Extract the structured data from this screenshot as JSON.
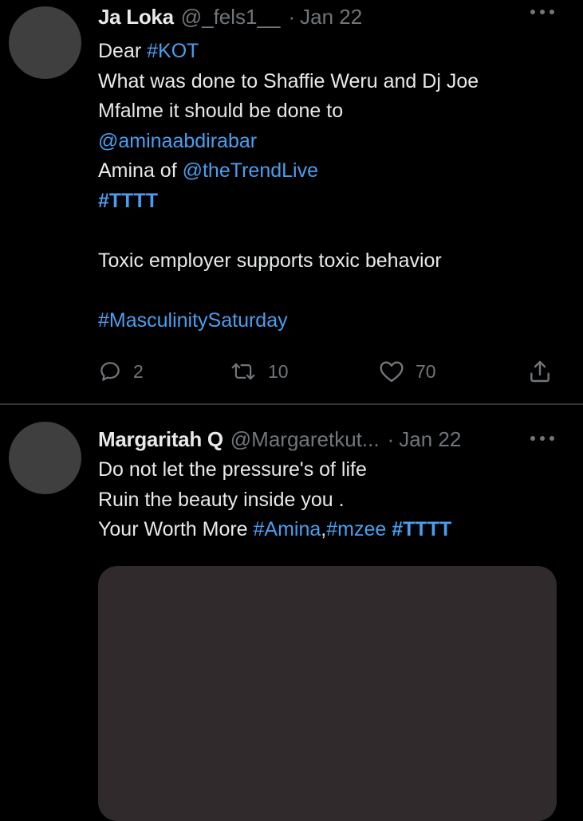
{
  "tweets": [
    {
      "name": "Ja Loka",
      "handle": "@_fels1__",
      "separator": "·",
      "date": "Jan 22",
      "text": {
        "l1_plain": "Dear ",
        "l1_tag": "#KOT",
        "l2": "What was done to Shaffie Weru and Dj Joe",
        "l3": "Mfalme it should be done to",
        "l4_mention": "@aminaabdirabar",
        "l5_plain": "Amina of ",
        "l5_mention": "@theTrendLive",
        "l6_tag": "#TTTT",
        "l8": "Toxic employer supports toxic behavior",
        "l10_tag": "#MasculinitySaturday"
      },
      "stats": {
        "replies": "2",
        "retweets": "10",
        "likes": "70"
      }
    },
    {
      "name": "Margaritah Q",
      "handle": "@Margaretkut...",
      "separator": "·",
      "date": "Jan 22",
      "text": {
        "l1": "Do not let the pressure's of life",
        "l2": "Ruin the beauty inside you .",
        "l3_plain": "Your Worth More ",
        "l3_tag1": "#Amina",
        "l3_comma": ",",
        "l3_tag2": "#mzee",
        "l3_space": " ",
        "l3_tag3": "#TTTT"
      }
    }
  ],
  "icons": {
    "reply": "reply-icon",
    "retweet": "retweet-icon",
    "like": "heart-icon",
    "share": "share-icon",
    "more": "more-icon"
  },
  "colors": {
    "background": "#000000",
    "text": "#e7e9ea",
    "muted": "#71767b",
    "link": "#4a9ef0",
    "media_placeholder": "#302a2d"
  }
}
